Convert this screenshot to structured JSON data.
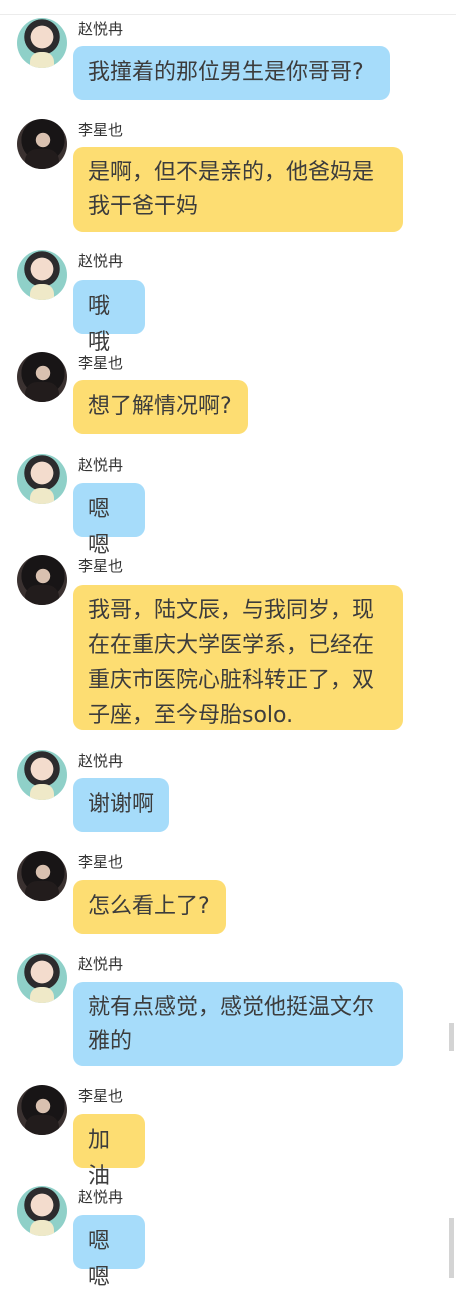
{
  "participants": {
    "zhao": {
      "name": "赵悦冉"
    },
    "li": {
      "name": "李星也"
    }
  },
  "messages": [
    {
      "sender": "赵悦冉",
      "text": "我撞着的那位男生是你哥哥?"
    },
    {
      "sender": "李星也",
      "text": "是啊，但不是亲的，他爸妈是我干爸干妈"
    },
    {
      "sender": "赵悦冉",
      "text": "哦哦"
    },
    {
      "sender": "李星也",
      "text": "想了解情况啊?"
    },
    {
      "sender": "赵悦冉",
      "text": "嗯嗯"
    },
    {
      "sender": "李星也",
      "text": "我哥，陆文辰，与我同岁，现在在重庆大学医学系，已经在重庆市医院心脏科转正了，双子座，至今母胎solo."
    },
    {
      "sender": "赵悦冉",
      "text": "谢谢啊"
    },
    {
      "sender": "李星也",
      "text": "怎么看上了?"
    },
    {
      "sender": "赵悦冉",
      "text": "就有点感觉，感觉他挺温文尔雅的"
    },
    {
      "sender": "李星也",
      "text": "加油"
    },
    {
      "sender": "赵悦冉",
      "text": "嗯嗯"
    }
  ],
  "colors": {
    "bubble_zhao": "#a6dcfa",
    "bubble_li": "#fddd72",
    "background": "#ffffff"
  }
}
